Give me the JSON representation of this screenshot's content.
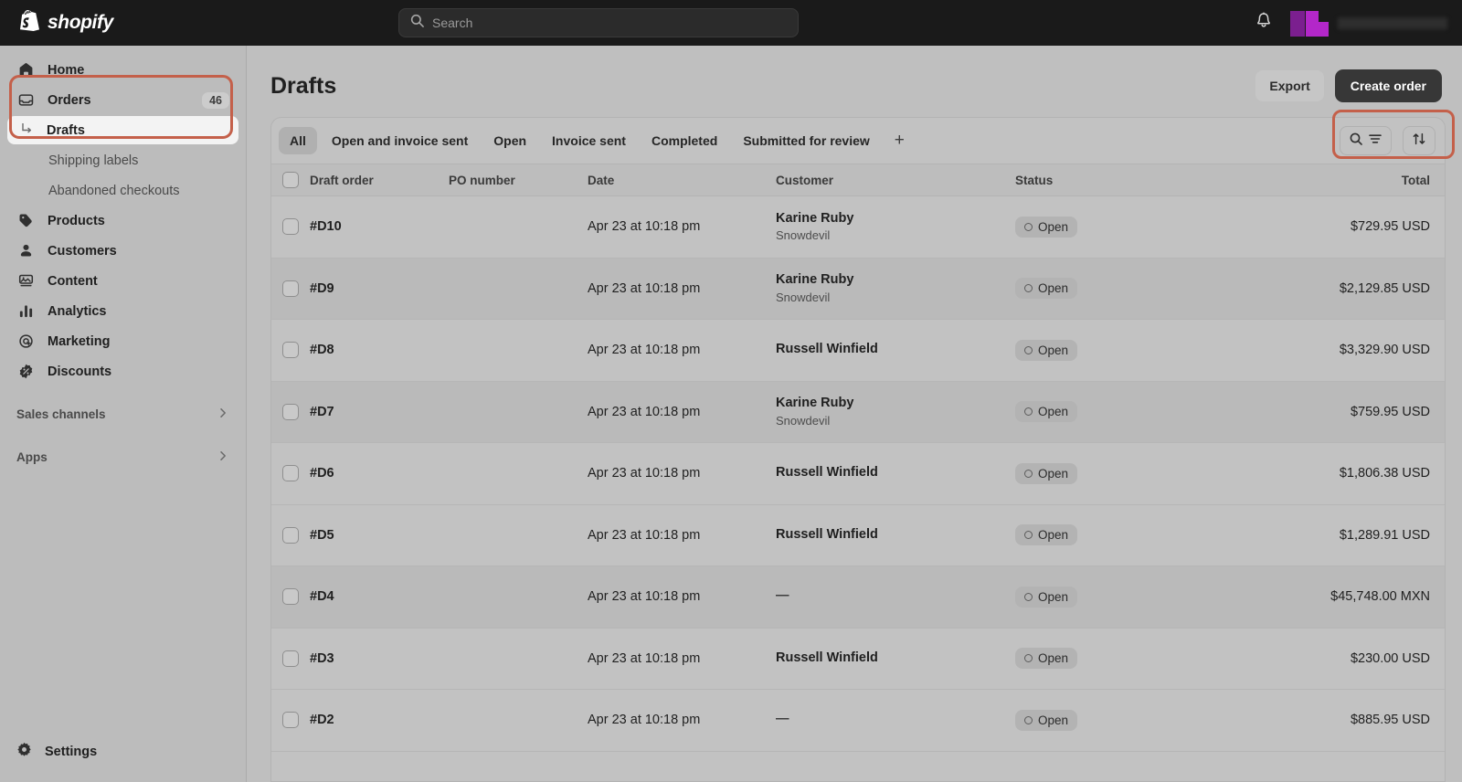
{
  "topbar": {
    "brand": "shopify",
    "brand_icon": "shopify-bag-icon",
    "search_placeholder": "Search",
    "search_value": "",
    "notifications_icon": "bell-icon",
    "account_name": ""
  },
  "sidebar": {
    "items": [
      {
        "label": "Home",
        "icon": "home-icon"
      },
      {
        "label": "Orders",
        "icon": "orders-inbox-icon",
        "count": "46"
      },
      {
        "label": "Drafts",
        "icon": "subnav-arrow-icon",
        "active": true
      },
      {
        "label": "Shipping labels"
      },
      {
        "label": "Abandoned checkouts"
      },
      {
        "label": "Products",
        "icon": "tag-icon"
      },
      {
        "label": "Customers",
        "icon": "person-icon"
      },
      {
        "label": "Content",
        "icon": "content-image-icon"
      },
      {
        "label": "Analytics",
        "icon": "bar-chart-icon"
      },
      {
        "label": "Marketing",
        "icon": "marketing-target-icon"
      },
      {
        "label": "Discounts",
        "icon": "discount-badge-icon"
      }
    ],
    "groups": [
      {
        "label": "Sales channels",
        "icon": "chevron-right-icon"
      },
      {
        "label": "Apps",
        "icon": "chevron-right-icon"
      }
    ],
    "settings": {
      "label": "Settings",
      "icon": "gear-icon"
    }
  },
  "page": {
    "title": "Drafts",
    "export_label": "Export",
    "create_label": "Create order"
  },
  "tabs": [
    {
      "label": "All",
      "active": true
    },
    {
      "label": "Open and invoice sent"
    },
    {
      "label": "Open"
    },
    {
      "label": "Invoice sent"
    },
    {
      "label": "Completed"
    },
    {
      "label": "Submitted for review"
    }
  ],
  "tab_add_label": "+",
  "toolbar": {
    "search_filter_icon": "search-filter-icon",
    "sort_icon": "sort-arrows-icon"
  },
  "table": {
    "columns": [
      "Draft order",
      "PO number",
      "Date",
      "Customer",
      "Status",
      "Total"
    ],
    "rows": [
      {
        "order": "#D10",
        "po": "",
        "date": "Apr 23 at 10:18 pm",
        "customer": "Karine Ruby",
        "customer_sub": "Snowdevil",
        "status": "Open",
        "total": "$729.95 USD"
      },
      {
        "order": "#D9",
        "po": "",
        "date": "Apr 23 at 10:18 pm",
        "customer": "Karine Ruby",
        "customer_sub": "Snowdevil",
        "status": "Open",
        "total": "$2,129.85 USD"
      },
      {
        "order": "#D8",
        "po": "",
        "date": "Apr 23 at 10:18 pm",
        "customer": "Russell Winfield",
        "customer_sub": "",
        "status": "Open",
        "total": "$3,329.90 USD"
      },
      {
        "order": "#D7",
        "po": "",
        "date": "Apr 23 at 10:18 pm",
        "customer": "Karine Ruby",
        "customer_sub": "Snowdevil",
        "status": "Open",
        "total": "$759.95 USD"
      },
      {
        "order": "#D6",
        "po": "",
        "date": "Apr 23 at 10:18 pm",
        "customer": "Russell Winfield",
        "customer_sub": "",
        "status": "Open",
        "total": "$1,806.38 USD"
      },
      {
        "order": "#D5",
        "po": "",
        "date": "Apr 23 at 10:18 pm",
        "customer": "Russell Winfield",
        "customer_sub": "",
        "status": "Open",
        "total": "$1,289.91 USD"
      },
      {
        "order": "#D4",
        "po": "",
        "date": "Apr 23 at 10:18 pm",
        "customer": "—",
        "customer_sub": "",
        "status": "Open",
        "total": "$45,748.00 MXN"
      },
      {
        "order": "#D3",
        "po": "",
        "date": "Apr 23 at 10:18 pm",
        "customer": "Russell Winfield",
        "customer_sub": "",
        "status": "Open",
        "total": "$230.00 USD"
      },
      {
        "order": "#D2",
        "po": "",
        "date": "Apr 23 at 10:18 pm",
        "customer": "—",
        "customer_sub": "",
        "status": "Open",
        "total": "$885.95 USD"
      }
    ]
  },
  "annotations": {
    "highlight_color": "#c4604a",
    "regions": [
      "sidebar-orders-drafts",
      "create-order-button"
    ]
  }
}
